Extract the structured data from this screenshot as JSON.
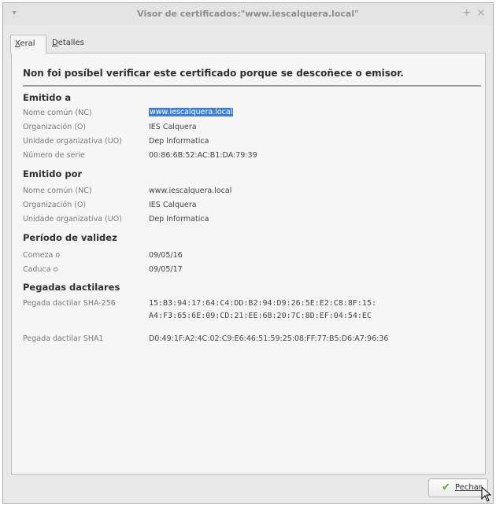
{
  "window": {
    "title": "Visor de certificados:\"www.iescalquera.local\"",
    "menu_glyph": "▾",
    "maximize_glyph": "+",
    "close_glyph": "×"
  },
  "tabs": {
    "general": {
      "first": "X",
      "rest": "eral"
    },
    "details": {
      "first": "D",
      "rest": "etalles"
    }
  },
  "warning": "Non foi posíbel verificar este certificado porque se descoñece o emisor.",
  "issued_to": {
    "heading": "Emitido a",
    "rows": [
      {
        "label": "Nome común (NC)",
        "value": "www.iescalquera.local"
      },
      {
        "label": "Organización (O)",
        "value": "IES Calquera"
      },
      {
        "label": "Unidade organizativa (UO)",
        "value": "Dep Informatica"
      },
      {
        "label": "Número de serie",
        "value": "00:86:6B:52:AC:B1:DA:79:39"
      }
    ]
  },
  "issued_by": {
    "heading": "Emitido por",
    "rows": [
      {
        "label": "Nome común (NC)",
        "value": "www.iescalquera.local"
      },
      {
        "label": "Organización (O)",
        "value": "IES Calquera"
      },
      {
        "label": "Unidade organizativa (UO)",
        "value": "Dep Informatica"
      }
    ]
  },
  "validity": {
    "heading": "Período de validez",
    "rows": [
      {
        "label": "Comeza o",
        "value": "09/05/16"
      },
      {
        "label": "Caduca o",
        "value": "09/05/17"
      }
    ]
  },
  "fingerprints": {
    "heading": "Pegadas dactilares",
    "sha256_label": "Pegada dactilar SHA-256",
    "sha256_line1": "15:B3:94:17:64:C4:DD:B2:94:D9:26:5E:E2:C8:8F:15:",
    "sha256_line2": "A4:F3:65:6E:09:CD:21:EE:68:20:7C:8D:EF:04:54:EC",
    "sha1_label": "Pegada dactilar SHA1",
    "sha1_value": "D0:49:1F:A2:4C:02:C9:E6:46:51:59:25:08:FF:77:B5:D6:A7:96:36"
  },
  "close_button": {
    "first": "P",
    "rest": "echar"
  },
  "colors": {
    "selection": "#3d7fd6",
    "check": "#5ab02f"
  }
}
